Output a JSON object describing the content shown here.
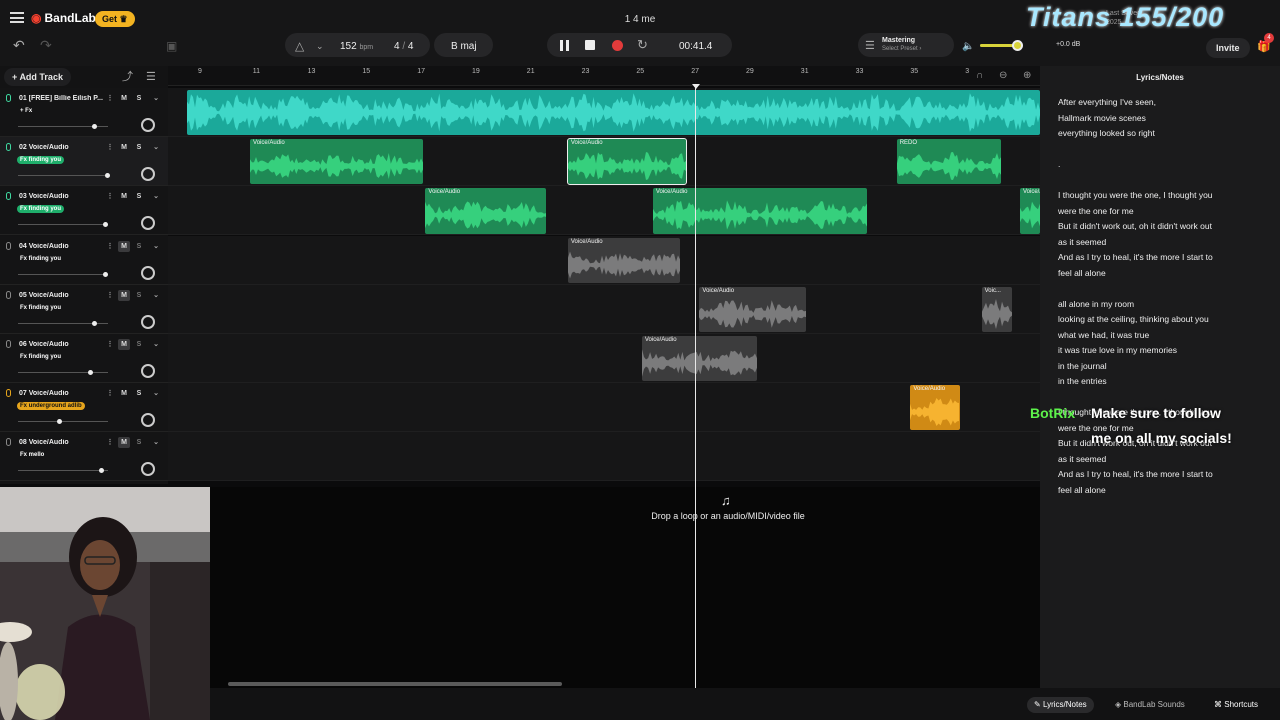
{
  "topbar": {
    "brand": "BandLab",
    "get_label": "Get",
    "title": "1 4 me",
    "last_saved": "Last Saved",
    "last_saved_date": "2025"
  },
  "toolbar": {
    "bpm": "152",
    "bpm_unit": "bpm",
    "time_sig_num": "4",
    "time_sig_den": "4",
    "key": "B maj",
    "time": "00:41.4",
    "mastering": "Mastering",
    "preset": "Select Preset",
    "gain": "+0.0 dB",
    "invite": "Invite",
    "badge": "4",
    "volume_level": 0.78
  },
  "add_track": "Add Track",
  "ruler": [
    "9",
    "11",
    "13",
    "15",
    "17",
    "19",
    "21",
    "23",
    "25",
    "27",
    "29",
    "31",
    "33",
    "35",
    "3"
  ],
  "tracks": [
    {
      "name": "01  [FREE] Billie Eilish P...",
      "fx": "+ Fx",
      "fx_color": "none",
      "mute": "M",
      "solo": "S",
      "volume": 0.85,
      "m_active": false
    },
    {
      "name": "02  Voice/Audio",
      "fx": "Fx  finding you",
      "fx_color": "#1fae6b",
      "mute": "M",
      "solo": "S",
      "volume": 1.0,
      "m_active": false
    },
    {
      "name": "03  Voice/Audio",
      "fx": "Fx  finding you",
      "fx_color": "#1fae6b",
      "mute": "M",
      "solo": "S",
      "volume": 0.98,
      "m_active": false
    },
    {
      "name": "04  Voice/Audio",
      "fx": "Fx  finding you",
      "fx_color": "none",
      "mute": "M",
      "solo": "S",
      "volume": 0.98,
      "m_active": true
    },
    {
      "name": "05  Voice/Audio",
      "fx": "Fx  finding you",
      "fx_color": "none",
      "mute": "M",
      "solo": "S",
      "volume": 0.85,
      "m_active": true
    },
    {
      "name": "06  Voice/Audio",
      "fx": "Fx  finding you",
      "fx_color": "none",
      "mute": "M",
      "solo": "S",
      "volume": 0.81,
      "m_active": true
    },
    {
      "name": "07  Voice/Audio",
      "fx": "Fx  underground adlib",
      "fx_color": "#e6a51c",
      "mute": "M",
      "solo": "S",
      "volume": 0.47,
      "m_active": false
    },
    {
      "name": "08  Voice/Audio",
      "fx": "Fx  mello",
      "fx_color": "none",
      "mute": "M",
      "solo": "S",
      "volume": 0.93,
      "m_active": true
    }
  ],
  "clips": [
    {
      "track": 0,
      "label": "",
      "start_beat": 8.6,
      "end_beat": 40.6,
      "color": "#1ba99a",
      "wave": "#3fd8c8"
    },
    {
      "track": 1,
      "label": "Voice/Audio",
      "start_beat": 10.9,
      "end_beat": 17.2,
      "color": "#1f8a55",
      "wave": "#36d07d"
    },
    {
      "track": 1,
      "label": "Voice/Audio",
      "start_beat": 22.5,
      "end_beat": 26.8,
      "color": "#1f8a55",
      "wave": "#36d07d",
      "selected": true
    },
    {
      "track": 1,
      "label": "REDO",
      "start_beat": 34.5,
      "end_beat": 38.3,
      "color": "#1f8a55",
      "wave": "#36d07d"
    },
    {
      "track": 2,
      "label": "Voice/Audio",
      "start_beat": 17.3,
      "end_beat": 21.7,
      "color": "#1f8a55",
      "wave": "#36d07d"
    },
    {
      "track": 2,
      "label": "Voice/Audio",
      "start_beat": 25.6,
      "end_beat": 33.4,
      "color": "#1f8a55",
      "wave": "#36d07d"
    },
    {
      "track": 2,
      "label": "Voice/Audio",
      "start_beat": 39.0,
      "end_beat": 40.6,
      "color": "#1f8a55",
      "wave": "#36d07d"
    },
    {
      "track": 3,
      "label": "Voice/Audio",
      "start_beat": 22.5,
      "end_beat": 26.6,
      "color": "#3c3c3d",
      "wave": "#7b7b7c"
    },
    {
      "track": 4,
      "label": "Voice/Audio",
      "start_beat": 27.3,
      "end_beat": 31.2,
      "color": "#3c3c3d",
      "wave": "#7b7b7c"
    },
    {
      "track": 4,
      "label": "Voic...",
      "start_beat": 37.6,
      "end_beat": 38.7,
      "color": "#3c3c3d",
      "wave": "#7b7b7c"
    },
    {
      "track": 5,
      "label": "Voice/Audio",
      "start_beat": 25.2,
      "end_beat": 29.4,
      "color": "#3c3c3d",
      "wave": "#7b7b7c"
    },
    {
      "track": 6,
      "label": "Voice/Audio",
      "start_beat": 35.0,
      "end_beat": 36.8,
      "color": "#d08a15",
      "wave": "#f6b330"
    }
  ],
  "drop_text": "Drop a loop or an audio/MIDI/video file",
  "panel": {
    "title": "Lyrics/Notes",
    "lines": [
      "After everything I've seen,",
      "Hallmark movie scenes",
      "everything looked so right",
      "",
      ".",
      "",
      "I thought you were the one, I thought you",
      "were the one for me",
      "But it didn't work out, oh it didn't work out",
      "as it seemed",
      "And as I try to heal, it's the more I start to",
      "feel all alone",
      "",
      "all alone in my room",
      "looking at the ceiling, thinking about you",
      "what we had, it was true",
      "it was true love in my memories",
      "in the journal",
      "in the entries",
      "",
      "I thought you were the one, I thought you",
      "were the one for me",
      "But it didn't work out, oh it didn't work out",
      "as it seemed",
      "And as I try to heal, it's the more I start to",
      "feel all alone"
    ]
  },
  "bottom": {
    "lyrics_tab": "Lyrics/Notes",
    "sounds_tab": "BandLab Sounds",
    "shortcuts_tab": "Shortcuts"
  },
  "overlay": {
    "titans": "Titans 155/200",
    "botrix": "BotRix",
    "follow_1": "Make sure to follow",
    "follow_2": "me on all my socials!"
  }
}
